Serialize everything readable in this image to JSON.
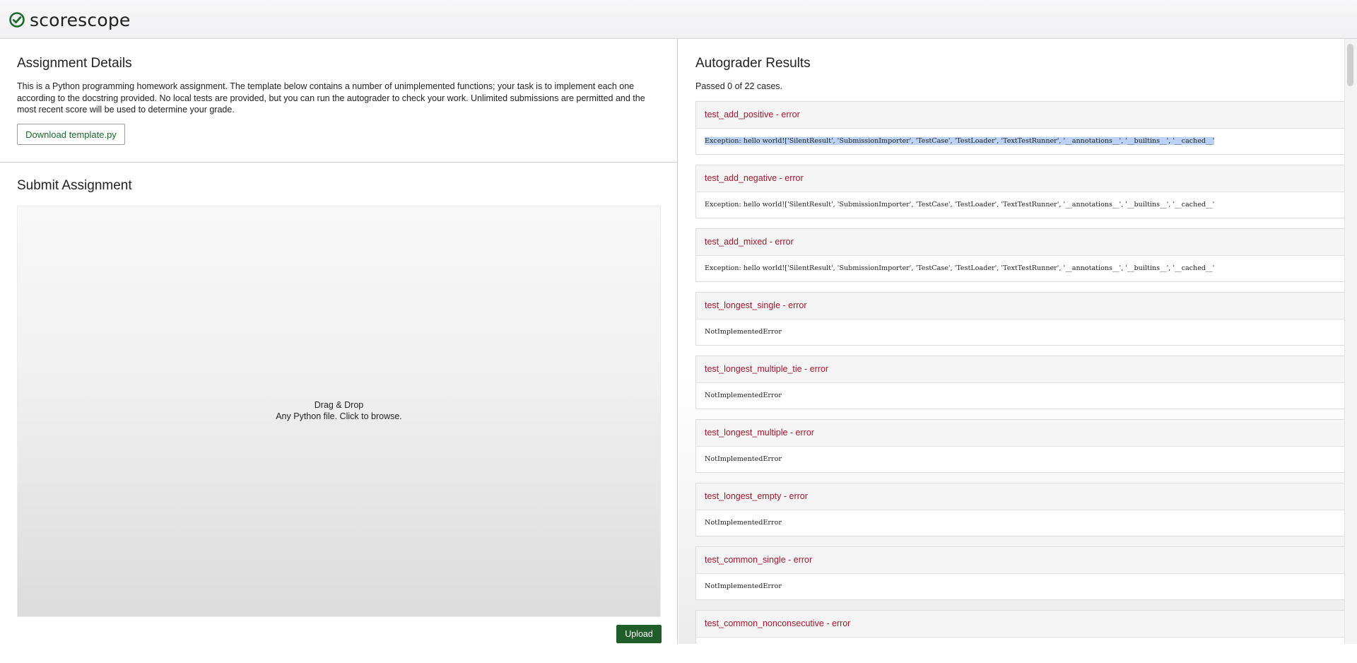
{
  "brand": {
    "name": "scorescope",
    "logo_color": "#1f6b2f"
  },
  "assignment_details": {
    "title": "Assignment Details",
    "description": "This is a Python programming homework assignment. The template below contains a number of unimplemented functions; your task is to implement each one according to the docstring provided. No local tests are provided, but you can run the autograder to check your work. Unlimited submissions are permitted and the most recent score will be used to determine your grade.",
    "download_label": "Download template.py"
  },
  "submit": {
    "title": "Submit Assignment",
    "dropzone_title": "Drag & Drop",
    "dropzone_hint": "Any Python file. Click to browse.",
    "upload_label": "Upload"
  },
  "autograder": {
    "title": "Autograder Results",
    "summary": "Passed 0 of 22 cases.",
    "results": [
      {
        "name": "test_add_positive - error",
        "message": "Exception: hello world!['SilentResult', 'SubmissionImporter', 'TestCase', 'TestLoader', 'TextTestRunner', '__annotations__', '__builtins__', '__cached__'",
        "selected": true
      },
      {
        "name": "test_add_negative - error",
        "message": "Exception: hello world!['SilentResult', 'SubmissionImporter', 'TestCase', 'TestLoader', 'TextTestRunner', '__annotations__', '__builtins__', '__cached__'"
      },
      {
        "name": "test_add_mixed - error",
        "message": "Exception: hello world!['SilentResult', 'SubmissionImporter', 'TestCase', 'TestLoader', 'TextTestRunner', '__annotations__', '__builtins__', '__cached__'"
      },
      {
        "name": "test_longest_single - error",
        "message": "NotImplementedError"
      },
      {
        "name": "test_longest_multiple_tie - error",
        "message": "NotImplementedError"
      },
      {
        "name": "test_longest_multiple - error",
        "message": "NotImplementedError"
      },
      {
        "name": "test_longest_empty - error",
        "message": "NotImplementedError"
      },
      {
        "name": "test_common_single - error",
        "message": "NotImplementedError"
      },
      {
        "name": "test_common_nonconsecutive - error",
        "message": ""
      }
    ]
  },
  "colors": {
    "error_text": "#a3182c",
    "upload_button": "#1f5e28",
    "selection": "#bcd2f4"
  }
}
